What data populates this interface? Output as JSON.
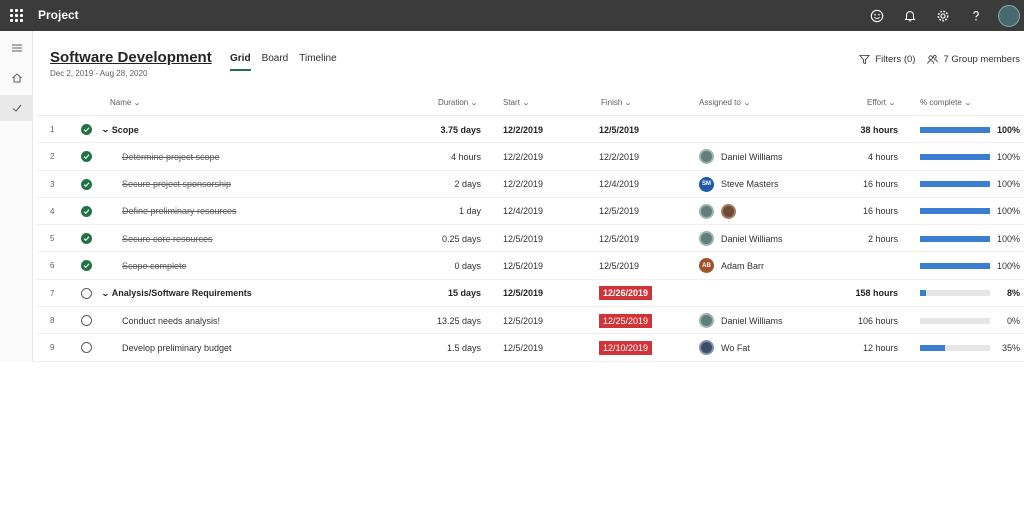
{
  "app": {
    "title": "Project"
  },
  "header": {
    "plan_title": "Software Development",
    "plan_dates": "Dec 2, 2019 - Aug 28, 2020",
    "tabs": [
      {
        "label": "Grid",
        "active": true
      },
      {
        "label": "Board",
        "active": false
      },
      {
        "label": "Timeline",
        "active": false
      }
    ],
    "filters_label": "Filters (0)",
    "members_label": "7 Group members"
  },
  "columns": {
    "name": "Name",
    "duration": "Duration",
    "start": "Start",
    "finish": "Finish",
    "assigned": "Assigned to",
    "effort": "Effort",
    "pct": "% complete"
  },
  "rows": [
    {
      "num": "1",
      "done": true,
      "summary": true,
      "name": "Scope",
      "duration": "3.75 days",
      "start": "12/2/2019",
      "finish": "12/5/2019",
      "late": false,
      "assignees": [],
      "assignee_name": "",
      "effort": "38 hours",
      "pct": 100,
      "pct_label": "100%"
    },
    {
      "num": "2",
      "done": true,
      "summary": false,
      "name": "Determine project scope",
      "duration": "4 hours",
      "start": "12/2/2019",
      "finish": "12/2/2019",
      "late": false,
      "assignees": [
        "photo1"
      ],
      "assignee_name": "Daniel Williams",
      "effort": "4 hours",
      "pct": 100,
      "pct_label": "100%"
    },
    {
      "num": "3",
      "done": true,
      "summary": false,
      "name": "Secure project sponsorship",
      "duration": "2 days",
      "start": "12/2/2019",
      "finish": "12/4/2019",
      "late": false,
      "assignees": [
        "sm"
      ],
      "assignee_name": "Steve Masters",
      "effort": "16 hours",
      "pct": 100,
      "pct_label": "100%"
    },
    {
      "num": "4",
      "done": true,
      "summary": false,
      "name": "Define preliminary resources",
      "duration": "1 day",
      "start": "12/4/2019",
      "finish": "12/5/2019",
      "late": false,
      "assignees": [
        "photo1",
        "photo2"
      ],
      "assignee_name": "",
      "effort": "16 hours",
      "pct": 100,
      "pct_label": "100%"
    },
    {
      "num": "5",
      "done": true,
      "summary": false,
      "name": "Secure core resources",
      "duration": "0.25 days",
      "start": "12/5/2019",
      "finish": "12/5/2019",
      "late": false,
      "assignees": [
        "photo1"
      ],
      "assignee_name": "Daniel Williams",
      "effort": "2 hours",
      "pct": 100,
      "pct_label": "100%"
    },
    {
      "num": "6",
      "done": true,
      "summary": false,
      "name": "Scope complete",
      "duration": "0 days",
      "start": "12/5/2019",
      "finish": "12/5/2019",
      "late": false,
      "assignees": [
        "ab"
      ],
      "assignee_name": "Adam Barr",
      "effort": "",
      "pct": 100,
      "pct_label": "100%"
    },
    {
      "num": "7",
      "done": false,
      "summary": true,
      "name": "Analysis/Software Requirements",
      "duration": "15 days",
      "start": "12/5/2019",
      "finish": "12/26/2019",
      "late": true,
      "assignees": [],
      "assignee_name": "",
      "effort": "158 hours",
      "pct": 8,
      "pct_label": "8%"
    },
    {
      "num": "8",
      "done": false,
      "summary": false,
      "name": "Conduct needs analysis!",
      "duration": "13.25 days",
      "start": "12/5/2019",
      "finish": "12/25/2019",
      "late": true,
      "assignees": [
        "photo1"
      ],
      "assignee_name": "Daniel Williams",
      "effort": "106 hours",
      "pct": 0,
      "pct_label": "0%"
    },
    {
      "num": "9",
      "done": false,
      "summary": false,
      "name": "Develop preliminary budget",
      "duration": "1.5 days",
      "start": "12/5/2019",
      "finish": "12/10/2019",
      "late": true,
      "assignees": [
        "wf"
      ],
      "assignee_name": "Wo Fat",
      "effort": "12 hours",
      "pct": 35,
      "pct_label": "35%"
    }
  ],
  "avatar_initials": {
    "sm": "SM",
    "ab": "AB"
  },
  "colors": {
    "accent_green": "#217346",
    "late_red": "#d13438",
    "progress_blue": "#3a7ed2"
  }
}
